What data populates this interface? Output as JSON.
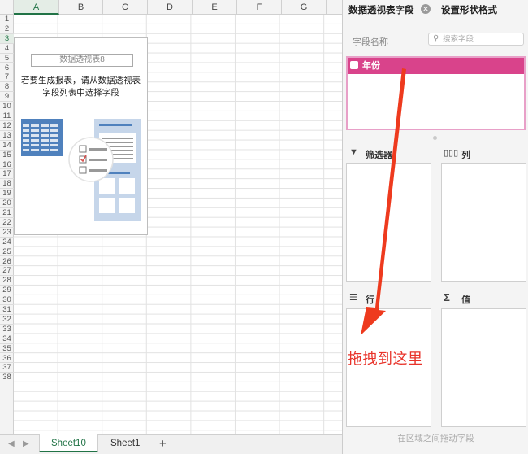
{
  "sheet": {
    "columns": [
      "A",
      "B",
      "C",
      "D",
      "E",
      "F",
      "G"
    ],
    "rows": [
      "1",
      "2",
      "3",
      "4",
      "5",
      "6",
      "7",
      "8",
      "9",
      "10",
      "11",
      "12",
      "13",
      "14",
      "15",
      "16",
      "17",
      "18",
      "19",
      "20",
      "21",
      "22",
      "23",
      "24",
      "25",
      "26",
      "27",
      "28",
      "29",
      "30",
      "31",
      "32",
      "33",
      "34",
      "35",
      "36",
      "37",
      "38"
    ],
    "active_column": "A",
    "active_row": "3"
  },
  "pivot_placeholder": {
    "name": "数据透视表8",
    "hint": "若要生成报表，请从数据透视表字段列表中选择字段"
  },
  "sheet_tabs": [
    {
      "label": "Sheet10",
      "active": true
    },
    {
      "label": "Sheet1",
      "active": false
    }
  ],
  "add_sheet_label": "+",
  "panel": {
    "tab_fields": "数据透视表字段",
    "tab_format": "设置形状格式",
    "field_name_label": "字段名称",
    "search_placeholder": "搜索字段",
    "fields": [
      {
        "label": "年份",
        "checked": false
      }
    ],
    "areas": {
      "filters": "筛选器",
      "columns": "列",
      "rows": "行",
      "values": "值"
    },
    "footer": "在区域之间拖动字段"
  },
  "annotation": {
    "text": "拖拽到这里",
    "color": "#e8332a"
  },
  "colors": {
    "accent": "#217346",
    "field_highlight": "#d9438b",
    "field_border": "#e8a0c8"
  }
}
